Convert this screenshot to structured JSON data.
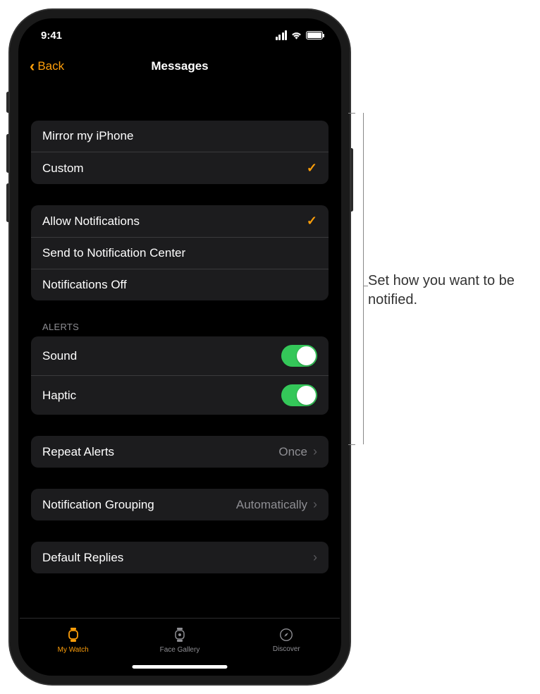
{
  "statusBar": {
    "time": "9:41"
  },
  "nav": {
    "back": "Back",
    "title": "Messages"
  },
  "mirrorGroup": {
    "items": [
      {
        "label": "Mirror my iPhone",
        "checked": false
      },
      {
        "label": "Custom",
        "checked": true
      }
    ]
  },
  "notifGroup": {
    "items": [
      {
        "label": "Allow Notifications",
        "checked": true
      },
      {
        "label": "Send to Notification Center",
        "checked": false
      },
      {
        "label": "Notifications Off",
        "checked": false
      }
    ]
  },
  "alerts": {
    "header": "ALERTS",
    "items": [
      {
        "label": "Sound",
        "on": true
      },
      {
        "label": "Haptic",
        "on": true
      }
    ]
  },
  "repeat": {
    "label": "Repeat Alerts",
    "value": "Once"
  },
  "grouping": {
    "label": "Notification Grouping",
    "value": "Automatically"
  },
  "replies": {
    "label": "Default Replies"
  },
  "tabs": {
    "items": [
      {
        "label": "My Watch",
        "active": true
      },
      {
        "label": "Face Gallery",
        "active": false
      },
      {
        "label": "Discover",
        "active": false
      }
    ]
  },
  "callout": {
    "text": "Set how you want to be notified."
  },
  "colors": {
    "accent": "#ff9f0a",
    "toggleOn": "#34c759"
  }
}
